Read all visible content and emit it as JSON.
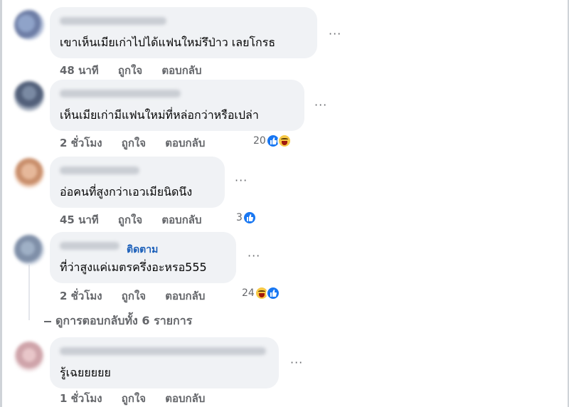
{
  "comments": [
    {
      "text": "เขาเห็นเมียเก่าไปได้แฟนใหม่รึป่าว เลยโกรธ",
      "time": "48 นาที",
      "like_label": "ถูกใจ",
      "reply_label": "ตอบกลับ",
      "reaction_count": "",
      "more_label": "···"
    },
    {
      "text": "เห็นเมียเก่ามีแฟนใหม่ที่หล่อกว่าหรือเปล่า",
      "time": "2 ชั่วโมง",
      "like_label": "ถูกใจ",
      "reply_label": "ตอบกลับ",
      "reaction_count": "20",
      "more_label": "···"
    },
    {
      "text": "อ่อคนที่สูงกว่าเอวเมียนิดนึง",
      "time": "45 นาที",
      "like_label": "ถูกใจ",
      "reply_label": "ตอบกลับ",
      "reaction_count": "3",
      "more_label": "···"
    },
    {
      "follow_label": "ติดตาม",
      "text": "ที่ว่าสูงแค่เมตรครึ่งอะหรอ555",
      "time": "2 ชั่วโมง",
      "like_label": "ถูกใจ",
      "reply_label": "ตอบกลับ",
      "reaction_count": "24",
      "more_label": "···"
    },
    {
      "text": "รู้เฉยยยยย",
      "time": "1 ชั่วโมง",
      "like_label": "ถูกใจ",
      "reply_label": "ตอบกลับ",
      "reaction_count": "",
      "more_label": "···"
    }
  ],
  "view_replies_label": "ดูการตอบกลับทั้ง 6 รายการ",
  "colors": {
    "bubble": "#f0f2f5",
    "meta_text": "#65676b",
    "like_blue": "#1877f2",
    "follow_blue": "#1b5fb9"
  },
  "icons": [
    "like-reaction-icon",
    "haha-reaction-icon",
    "more-options-icon"
  ]
}
